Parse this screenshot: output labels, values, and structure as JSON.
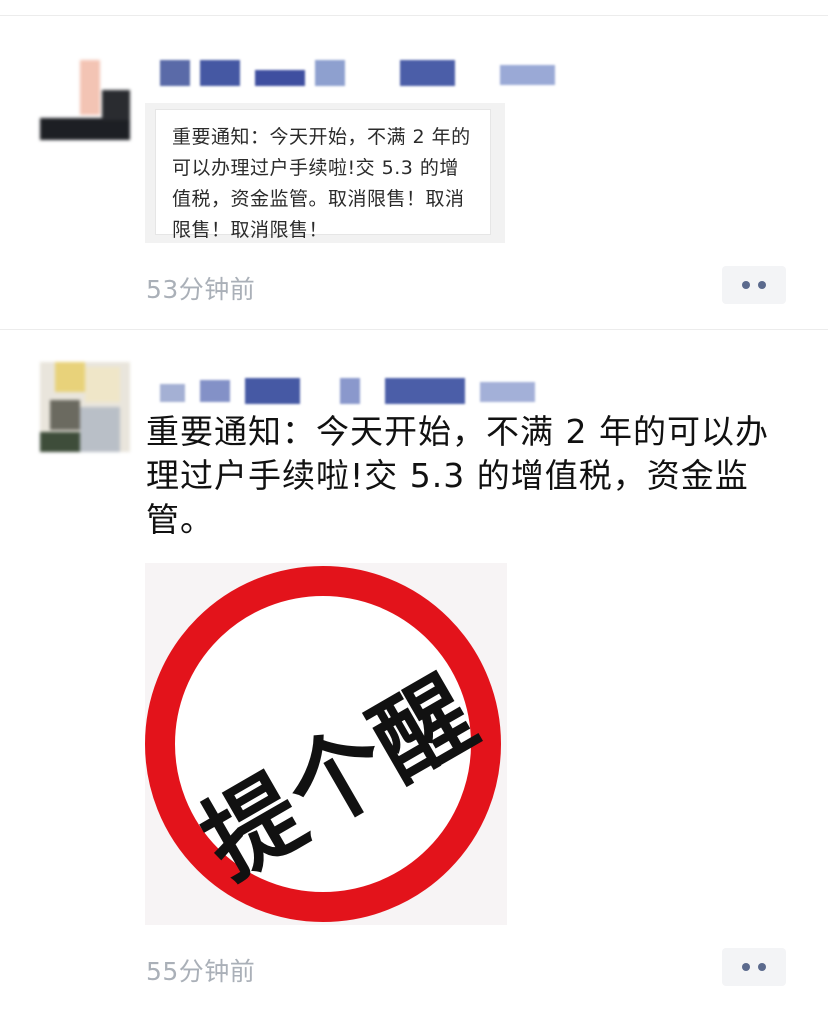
{
  "post1": {
    "shared_card": {
      "text": "重要通知：今天开始，不满 2 年的可以办理过户手续啦!交 5.3 的增值税，资金监管。取消限售！取消限售！取消限售！"
    },
    "timestamp": "53分钟前",
    "more_icon": "more-dots-icon"
  },
  "post2": {
    "text": "重要通知：今天开始，不满 2 年的可以办理过户手续啦!交 5.3 的增值税，资金监管。",
    "image": {
      "sign_text": "提个醒",
      "sign_color": "#e3131b"
    },
    "timestamp": "55分钟前",
    "more_icon": "more-dots-icon"
  },
  "colors": {
    "timestamp": "#aab0b8",
    "more_dots": "#5b6a8d",
    "sign_red": "#e3131b"
  }
}
